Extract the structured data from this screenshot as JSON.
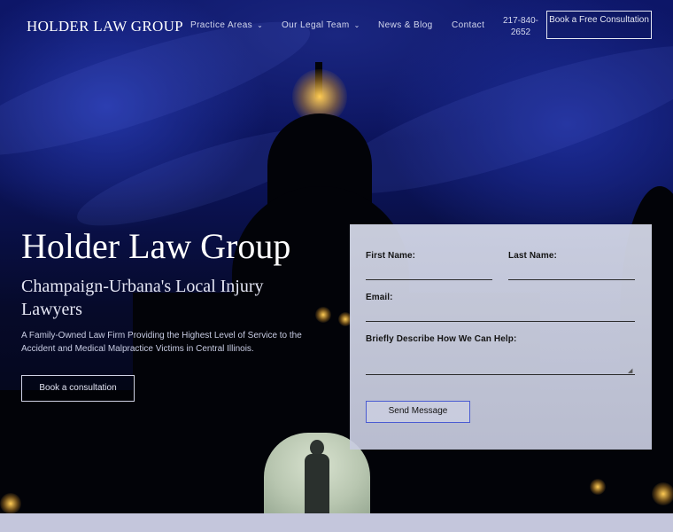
{
  "nav": {
    "logo": "HOLDER LAW GROUP",
    "items": [
      {
        "label": "Practice Areas",
        "has_dropdown": true
      },
      {
        "label": "Our Legal Team",
        "has_dropdown": true
      },
      {
        "label": "News & Blog",
        "has_dropdown": false
      },
      {
        "label": "Contact",
        "has_dropdown": false
      }
    ],
    "phone": "217-840-2652",
    "cta": "Book a Free Consultation"
  },
  "hero": {
    "title": "Holder Law Group",
    "subtitle": "Champaign-Urbana's Local Injury Lawyers",
    "description": "A Family-Owned Law Firm Providing the Highest Level of Service to the Accident and Medical Malpractice Victims in Central Illinois.",
    "button": "Book a consultation"
  },
  "form": {
    "first_name_label": "First Name:",
    "last_name_label": "Last Name:",
    "email_label": "Email:",
    "message_label": "Briefly Describe How We Can Help:",
    "submit": "Send Message"
  },
  "icons": {
    "dropdown": "chevron-down-icon",
    "resize": "resize-grip-icon"
  },
  "colors": {
    "form_panel": "#d2d6e6",
    "button_border": "#4a5bd2",
    "footer_strip": "#c4c6dc"
  }
}
